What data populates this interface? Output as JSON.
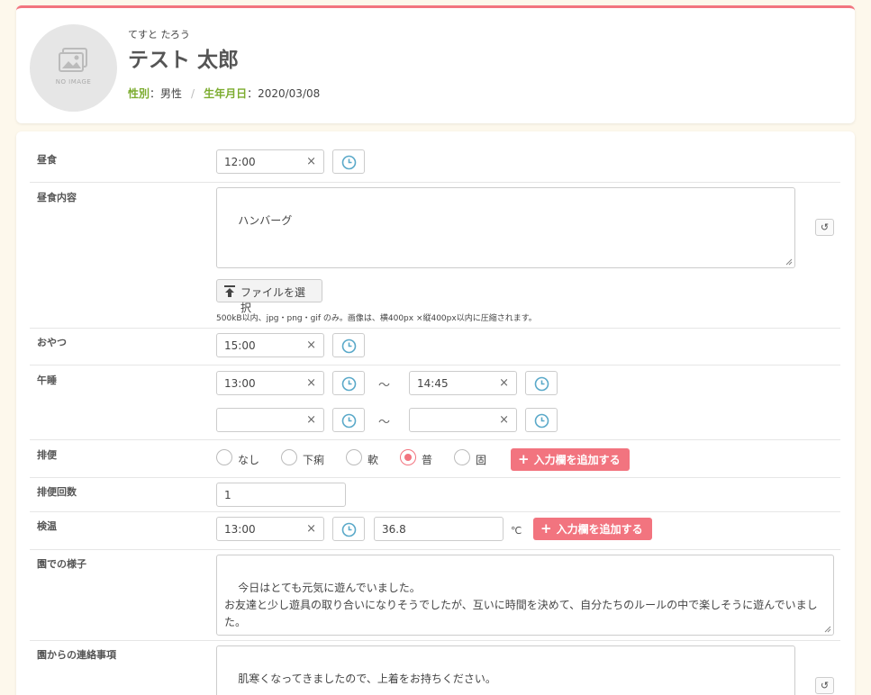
{
  "profile": {
    "kana": "てすと たろう",
    "name": "テスト 太郎",
    "no_image": "NO IMAGE",
    "gender_label": "性別",
    "gender_value": "：男性",
    "separator": "/",
    "birth_label": "生年月日",
    "birth_value": "：2020/03/08"
  },
  "form": {
    "lunch": {
      "label": "昼食",
      "time": "12:00"
    },
    "lunch_content": {
      "label": "昼食内容",
      "text": "ハンバーグ",
      "file_button": "ファイルを選択",
      "file_note": "500kB以内、jpg・png・gif のみ。画像は、横400px ×縦400px以内に圧縮されます。"
    },
    "snack": {
      "label": "おやつ",
      "time": "15:00"
    },
    "nap": {
      "label": "午睡",
      "row1_start": "13:00",
      "row1_end": "14:45",
      "row2_start": "",
      "row2_end": "",
      "tilde": "～"
    },
    "bowel": {
      "label": "排便",
      "options": [
        "なし",
        "下痢",
        "軟",
        "普",
        "固"
      ],
      "selected": "普",
      "add_button": "入力欄を追加する"
    },
    "bowel_count": {
      "label": "排便回数",
      "value": "1"
    },
    "temperature": {
      "label": "検温",
      "time": "13:00",
      "value": "36.8",
      "unit": "℃",
      "add_button": "入力欄を追加する"
    },
    "nursery_status": {
      "label": "園での様子",
      "text": "今日はとても元気に遊んでいました。\nお友達と少し遊具の取り合いになりそうでしたが、互いに時間を決めて、自分たちのルールの中で楽しそうに遊んでいました。"
    },
    "nursery_notice": {
      "label": "園からの連絡事項",
      "text": "肌寒くなってきましたので、上着をお持ちください。"
    },
    "clear_glyph": "×",
    "reset_glyph": "↺",
    "plus_glyph": "+"
  },
  "colors": {
    "accent": "#f2747f",
    "label_green": "#7cac2f",
    "clock_blue": "#5aa9c9"
  },
  "icons": [
    "image-placeholder-icon",
    "clock-icon",
    "clear-icon",
    "upload-icon",
    "reset-icon",
    "plus-icon",
    "resize-grip-icon"
  ]
}
